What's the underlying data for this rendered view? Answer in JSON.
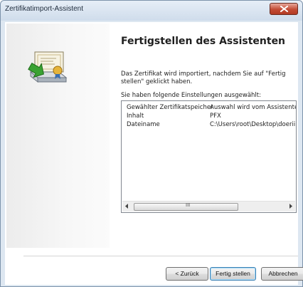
{
  "window": {
    "title": "Zertifikatimport-Assistent",
    "close_icon": "close-icon"
  },
  "wizard": {
    "heading": "Fertigstellen des Assistenten",
    "description": "Das Zertifikat wird importiert, nachdem Sie auf \"Fertig stellen\" geklickt haben.",
    "settings_label": "Sie haben folgende Einstellungen ausgewählt:",
    "settings": [
      {
        "name": "Gewählter Zertifikatspeicher",
        "value": "Auswahl wird vom Assistente"
      },
      {
        "name": "Inhalt",
        "value": "PFX"
      },
      {
        "name": "Dateiname",
        "value": "C:\\Users\\root\\Desktop\\doerii"
      }
    ],
    "scrollbar_grip": "III"
  },
  "buttons": {
    "back": "< Zurück",
    "finish": "Fertig stellen",
    "cancel": "Abbrechen"
  },
  "colors": {
    "title_bar": "#cfdceb",
    "close_button": "#c34b34",
    "default_button_border": "#3c7fb1"
  }
}
